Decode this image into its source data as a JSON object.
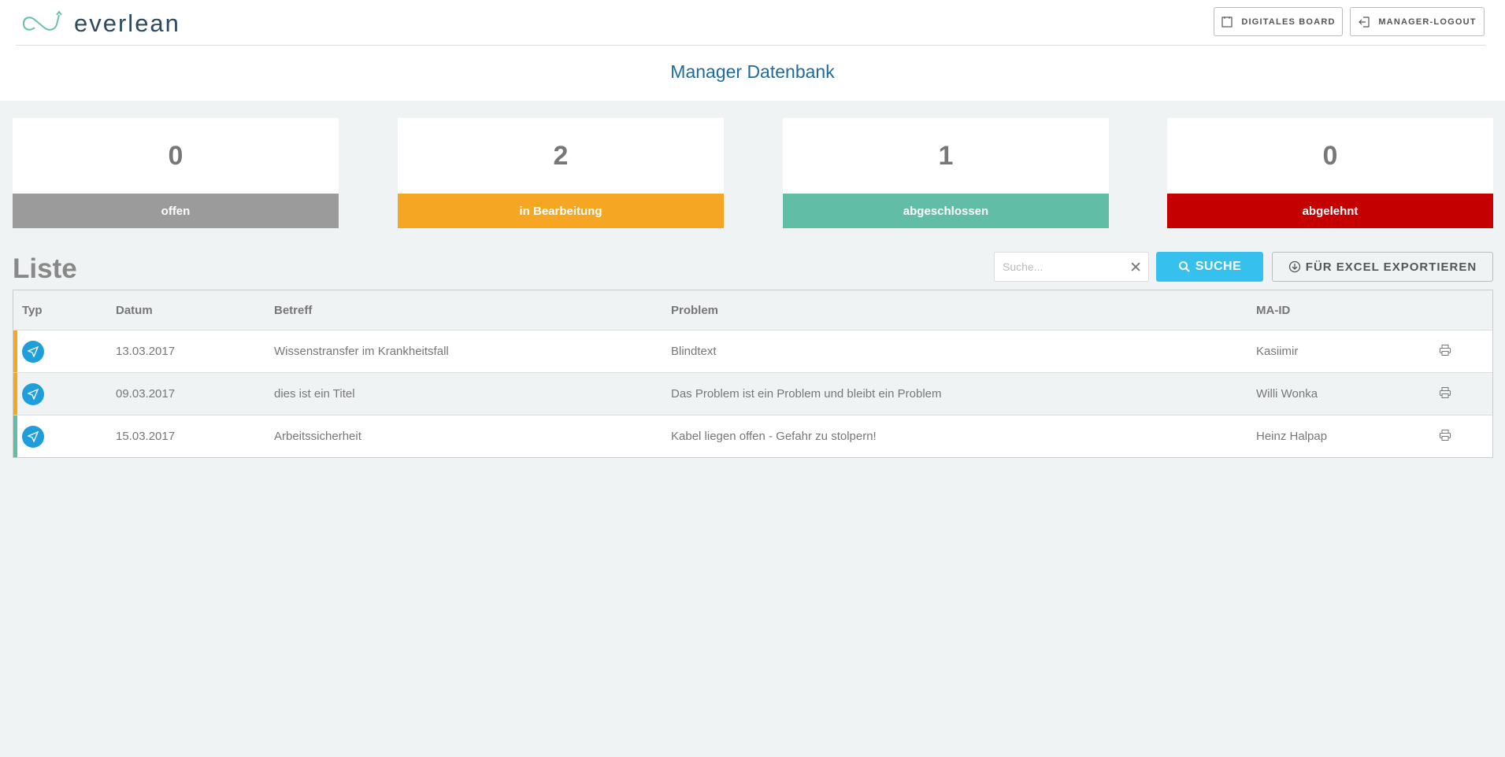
{
  "brand": {
    "logo_text": "everlean"
  },
  "header": {
    "board_label": "DIGITALES BOARD",
    "logout_label": "MANAGER-LOGOUT"
  },
  "page_title": "Manager Datenbank",
  "stats": [
    {
      "count": "0",
      "label": "offen",
      "color": "#9b9b9b"
    },
    {
      "count": "2",
      "label": "in Bearbeitung",
      "color": "#f5a623"
    },
    {
      "count": "1",
      "label": "abgeschlossen",
      "color": "#62bda6"
    },
    {
      "count": "0",
      "label": "abgelehnt",
      "color": "#c40000"
    }
  ],
  "list": {
    "title": "Liste",
    "search_placeholder": "Suche...",
    "search_value": "",
    "search_label": "SUCHE",
    "export_label": "FÜR EXCEL EXPORTIEREN",
    "columns": [
      "Typ",
      "Datum",
      "Betreff",
      "Problem",
      "MA-ID"
    ],
    "rows": [
      {
        "datum": "13.03.2017",
        "betreff": "Wissenstransfer im Krankheitsfall",
        "problem": "Blindtext",
        "ma_id": "Kasiimir",
        "status_color": "#f5a623"
      },
      {
        "datum": "09.03.2017",
        "betreff": "dies ist ein Titel",
        "problem": "Das Problem ist ein Problem und bleibt ein Problem",
        "ma_id": "Willi Wonka",
        "status_color": "#f5a623"
      },
      {
        "datum": "15.03.2017",
        "betreff": "Arbeitssicherheit",
        "problem": "Kabel liegen offen - Gefahr zu stolpern!",
        "ma_id": "Heinz Halpap",
        "status_color": "#62bda6"
      }
    ]
  }
}
